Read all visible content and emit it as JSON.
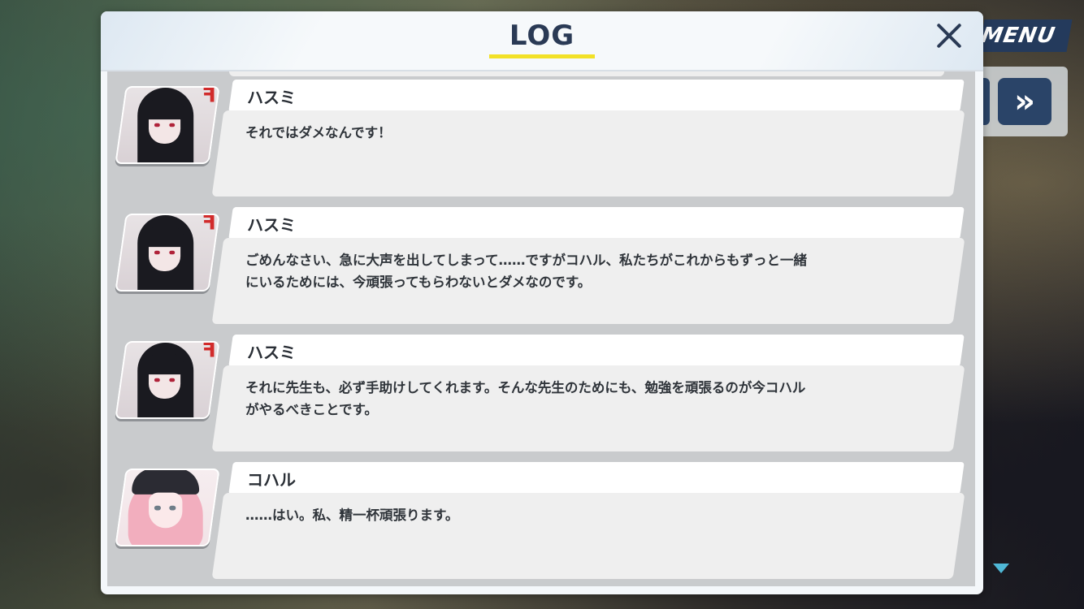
{
  "hud": {
    "menu_label": "MENU",
    "skip_label": "»"
  },
  "log": {
    "title": "LOG",
    "close_label": "✕",
    "entries": [
      {
        "speaker": "ハスミ",
        "avatar": "hasumi-portrait",
        "text": "それではダメなんです！"
      },
      {
        "speaker": "ハスミ",
        "avatar": "hasumi-portrait",
        "text": "ごめんなさい、急に大声を出してしまって……ですがコハル、私たちがこれからもずっと一緒\nにいるためには、今頑張ってもらわないとダメなのです。"
      },
      {
        "speaker": "ハスミ",
        "avatar": "hasumi-portrait",
        "text": "それに先生も、必ず手助けしてくれます。そんな先生のためにも、勉強を頑張るのが今コハル\nがやるべきことです。"
      },
      {
        "speaker": "コハル",
        "avatar": "koharu-portrait",
        "text": "……はい。私、精一杯頑張ります。"
      }
    ]
  },
  "colors": {
    "title_text": "#2a3a55",
    "title_underline": "#f2e127",
    "menu_bg": "#243a5c",
    "list_bg": "#c9cbcd",
    "bubble_bg": "#efefef"
  }
}
